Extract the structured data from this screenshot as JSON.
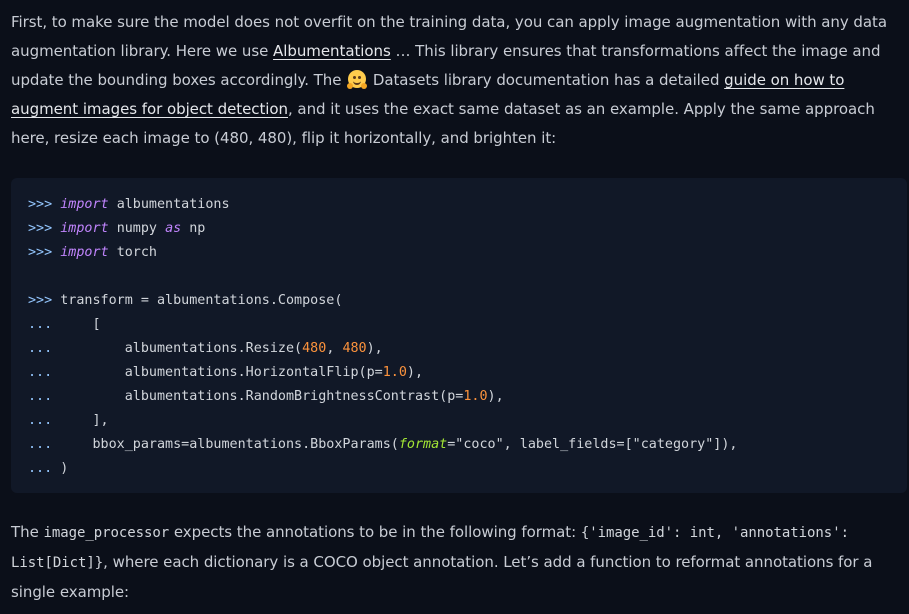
{
  "intro": {
    "t1": "First, to make sure the model does not overfit on the training data, you can apply image augmentation with any data augmentation library. Here we use ",
    "link_albumentations": "Albumentations",
    "t2": " … This library ensures that transformations affect the image and update the bounding boxes accordingly. The ",
    "hug_icon": "hugging-face-icon",
    "t3": " Datasets library documentation has a detailed ",
    "link_guide": "guide on how to augment images for object detection",
    "t4": ", and it uses the exact same dataset as an example. Apply the same approach here, resize each image to (480, 480), flip it horizontally, and brighten it:"
  },
  "code": {
    "prompt_main": ">>>",
    "prompt_cont": "...",
    "kw_import": "import",
    "kw_as": "as",
    "mod_albumentations": "albumentations",
    "mod_numpy": "numpy",
    "alias_np": "np",
    "mod_torch": "torch",
    "line_transform": "transform = albumentations.Compose(",
    "bracket_open": "[",
    "resize_pre": "albumentations.Resize(",
    "resize_w": "480",
    "resize_sep": ", ",
    "resize_h": "480",
    "resize_post": "),",
    "flip_pre": "albumentations.HorizontalFlip(p=",
    "flip_p": "1.0",
    "flip_post": "),",
    "bright_pre": "albumentations.RandomBrightnessContrast(p=",
    "bright_p": "1.0",
    "bright_post": "),",
    "bracket_close": "],",
    "bbox_pre": "bbox_params=albumentations.BboxParams(",
    "bbox_kw": "format",
    "bbox_mid": "=\"coco\", label_fields=[\"category\"]),",
    "paren_close": ")"
  },
  "outro": {
    "t1": "The ",
    "code_processor": "image_processor",
    "t2": " expects the annotations to be in the following format: ",
    "code_format": "{'image_id': int, 'annotations': List[Dict]}",
    "t3": ", where each dictionary is a COCO object annotation. Let’s add a function to reformat annotations for a single example:"
  },
  "colors": {
    "background": "#0b0f19",
    "code_background": "#111827",
    "keyword": "#c084fc",
    "number": "#fb923c",
    "prompt": "#93c5fd"
  }
}
